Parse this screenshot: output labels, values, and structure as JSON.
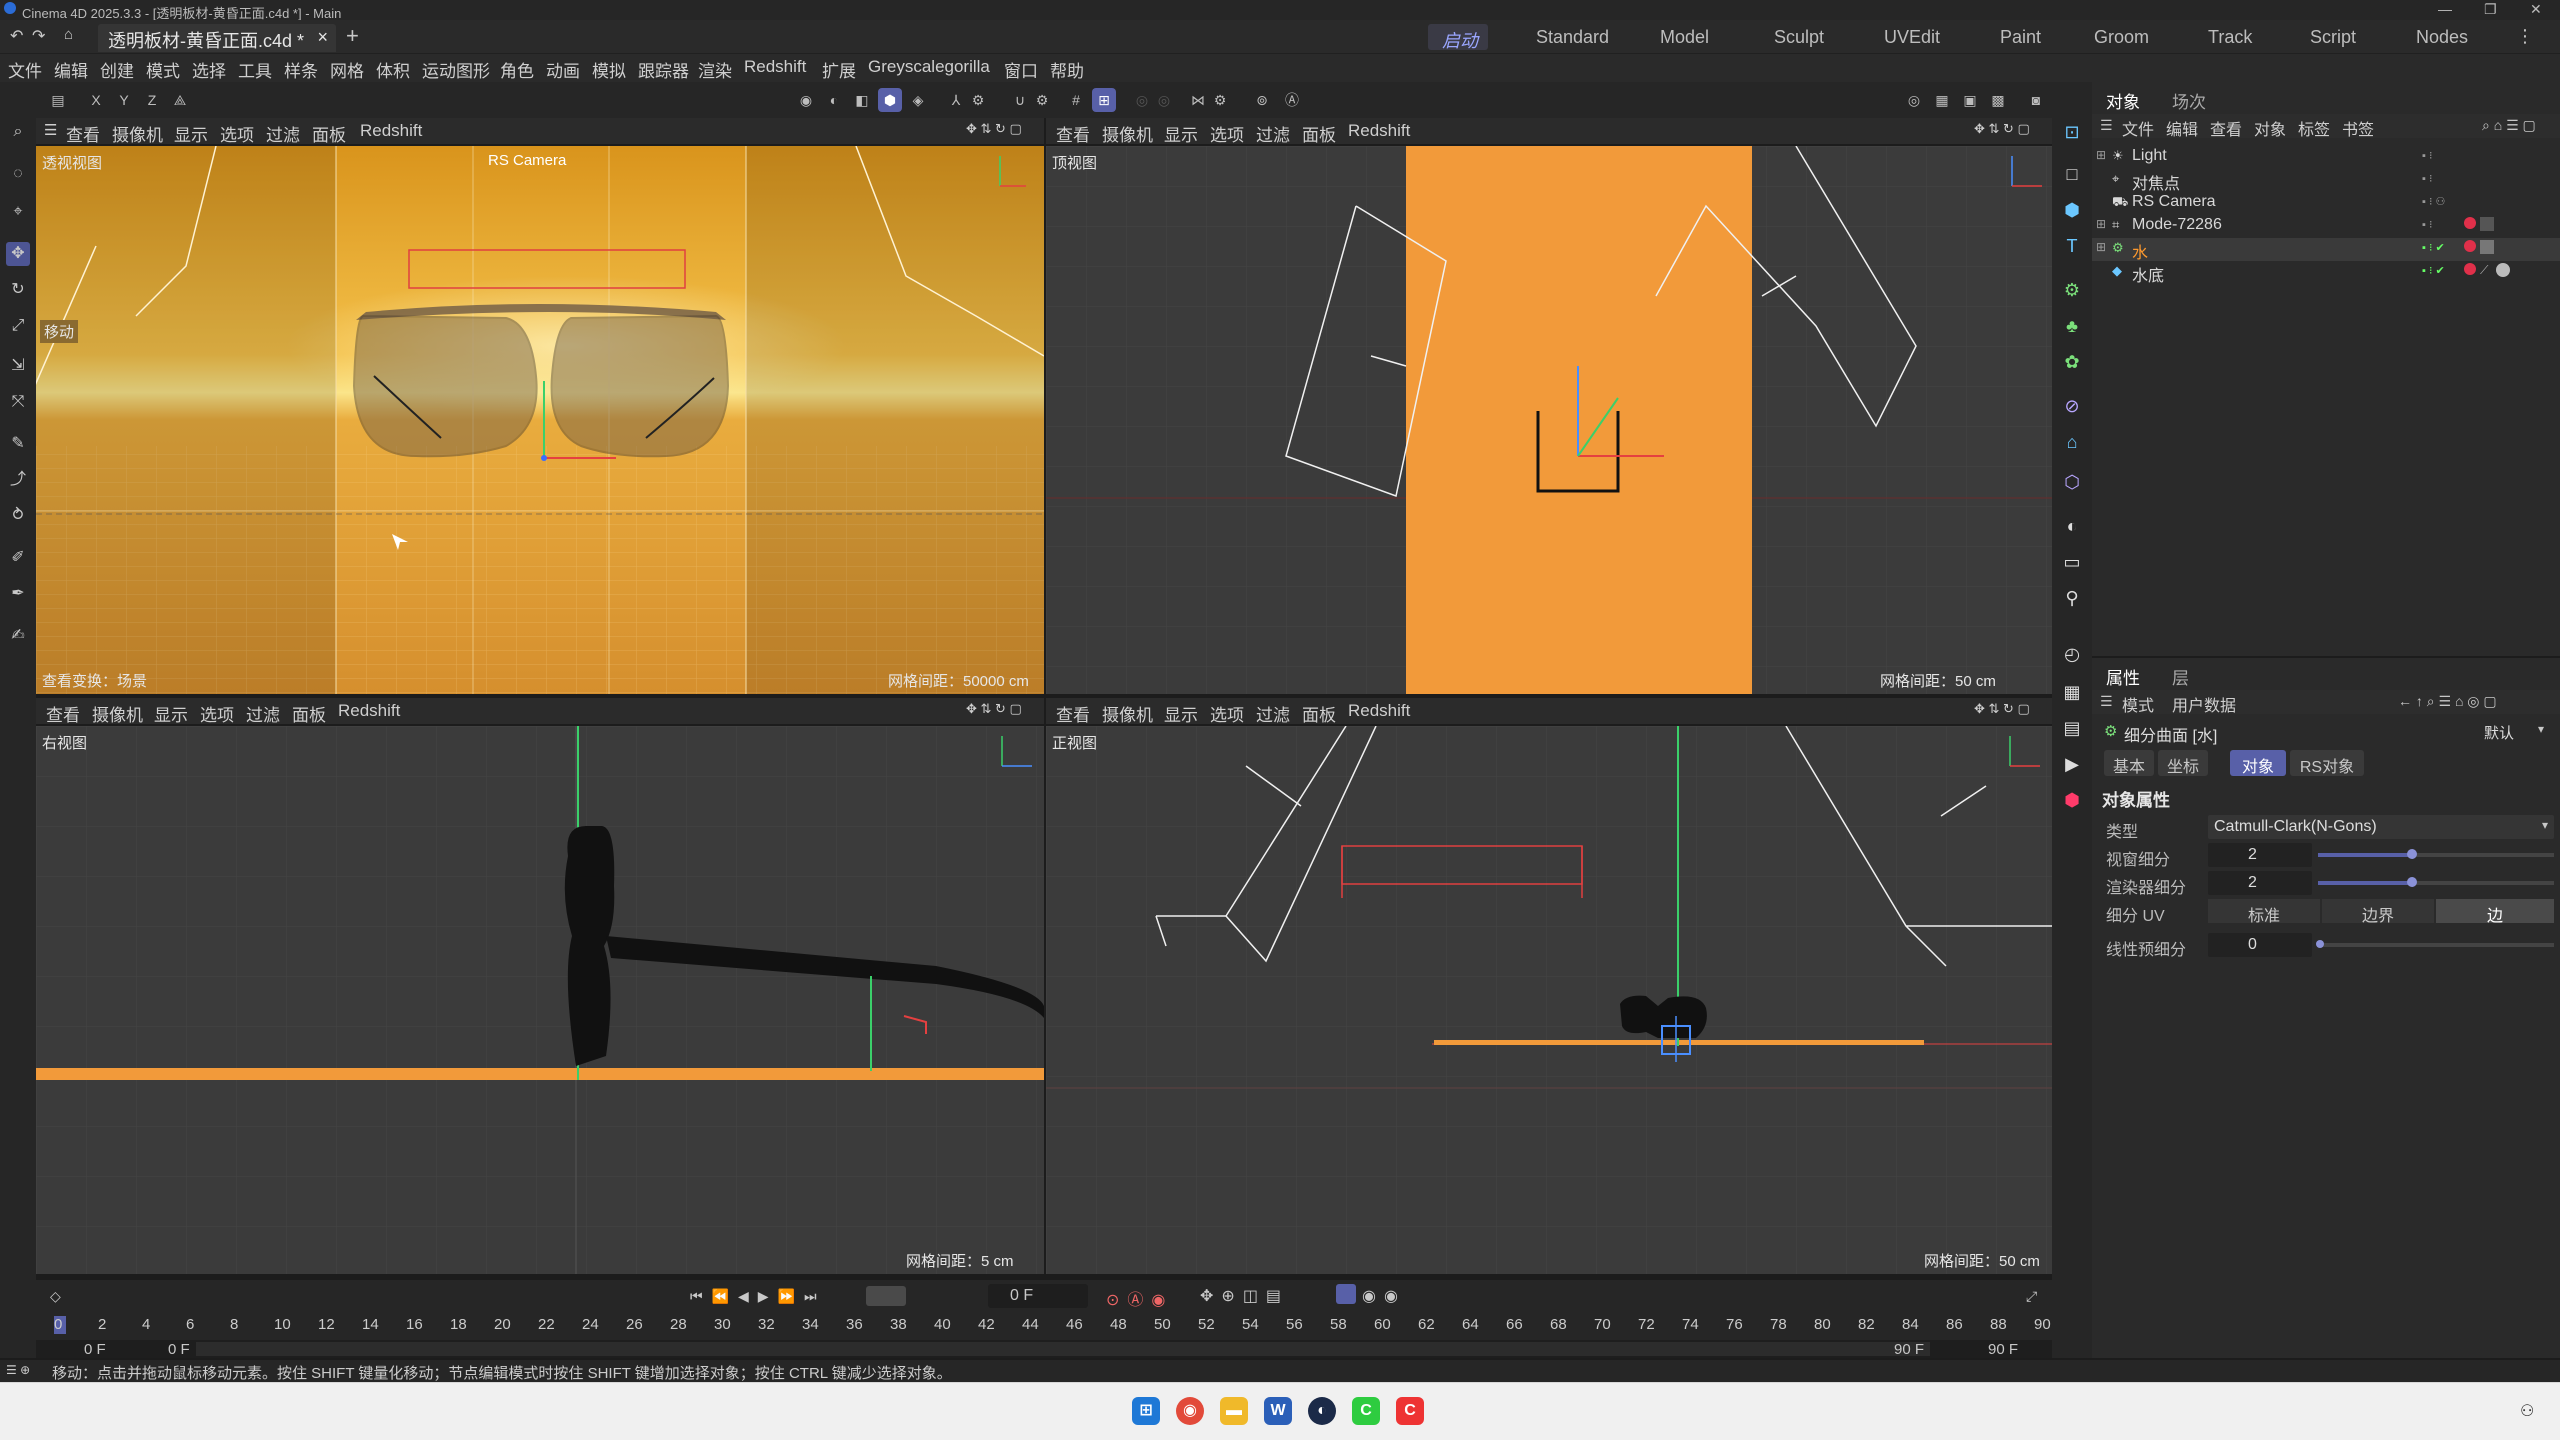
{
  "window": {
    "title": "Cinema 4D 2025.3.3 - [透明板材-黄昏正面.c4d *] - Main"
  },
  "doc_tab": {
    "label": "透明板材-黄昏正面.c4d *",
    "close": "×",
    "add": "+"
  },
  "layouts": [
    "启动",
    "Standard",
    "Model",
    "Sculpt",
    "UVEdit",
    "Paint",
    "Groom",
    "Track",
    "Script",
    "Nodes"
  ],
  "menu": [
    "文件",
    "编辑",
    "创建",
    "模式",
    "选择",
    "工具",
    "样条",
    "网格",
    "体积",
    "运动图形",
    "角色",
    "动画",
    "模拟",
    "跟踪器",
    "渲染",
    "Redshift",
    "扩展",
    "Greyscalegorilla",
    "窗口",
    "帮助"
  ],
  "axis_lock": [
    "X",
    "Y",
    "Z"
  ],
  "viewport_menu": [
    "查看",
    "摄像机",
    "显示",
    "选项",
    "过滤",
    "面板",
    "Redshift"
  ],
  "viewports": {
    "perspective": {
      "name": "透视视图",
      "camera": "RS Camera",
      "move_tag": "移动",
      "status": "查看变换：场景",
      "grid": "网格间距：50000 cm"
    },
    "top": {
      "name": "顶视图",
      "grid": "网格间距：50 cm"
    },
    "right": {
      "name": "右视图",
      "grid": "网格间距：5 cm"
    },
    "front": {
      "name": "正视图",
      "grid": "网格间距：50 cm"
    }
  },
  "object_panel": {
    "tabs": [
      "对象",
      "场次"
    ],
    "menu": [
      "文件",
      "编辑",
      "查看",
      "对象",
      "标签",
      "书签"
    ],
    "objects": [
      {
        "name": "Light",
        "color": "#d8d8d8"
      },
      {
        "name": "对焦点",
        "color": "#d8d8d8"
      },
      {
        "name": "RS Camera",
        "color": "#d8d8d8"
      },
      {
        "name": "Mode-72286",
        "color": "#d8d8d8"
      },
      {
        "name": "水",
        "color": "#ff9a2e"
      },
      {
        "name": "水底",
        "color": "#d8d8d8"
      }
    ]
  },
  "attr_panel": {
    "tabs": [
      "属性",
      "层"
    ],
    "menu": [
      "模式",
      "用户数据"
    ],
    "object_title": "细分曲面 [水]",
    "preset": "默认",
    "subtabs": [
      "基本",
      "坐标",
      "对象",
      "RS对象"
    ],
    "section": "对象属性",
    "type_label": "类型",
    "type_value": "Catmull-Clark(N-Gons)",
    "viewport_sub_label": "视窗细分",
    "viewport_sub_value": "2",
    "viewport_sub_level": 0.4,
    "render_sub_label": "渲染器细分",
    "render_sub_value": "2",
    "render_sub_level": 0.4,
    "uv_label": "细分 UV",
    "uv_options": [
      "标准",
      "边界",
      "边"
    ],
    "linear_label": "线性预细分",
    "linear_value": "0"
  },
  "timeline": {
    "current_frame": "0 F",
    "ticks": [
      "0",
      "2",
      "4",
      "6",
      "8",
      "10",
      "12",
      "14",
      "16",
      "18",
      "20",
      "22",
      "24",
      "26",
      "28",
      "30",
      "32",
      "34",
      "36",
      "38",
      "40",
      "42",
      "44",
      "46",
      "48",
      "50",
      "52",
      "54",
      "56",
      "58",
      "60",
      "62",
      "64",
      "66",
      "68",
      "70",
      "72",
      "74",
      "76",
      "78",
      "80",
      "82",
      "84",
      "86",
      "88",
      "90"
    ],
    "start": "0 F",
    "start2": "0 F",
    "end": "90 F",
    "end2": "90 F"
  },
  "status": {
    "text": "移动：点击并拖动鼠标移动元素。按住 SHIFT 键量化移动；节点编辑模式时按住 SHIFT 键增加选择对象；按住 CTRL 键减少选择对象。"
  },
  "colors": {
    "accent": "#5860a8",
    "orange": "#f29a3a",
    "sky_gold": "#e8a020"
  }
}
